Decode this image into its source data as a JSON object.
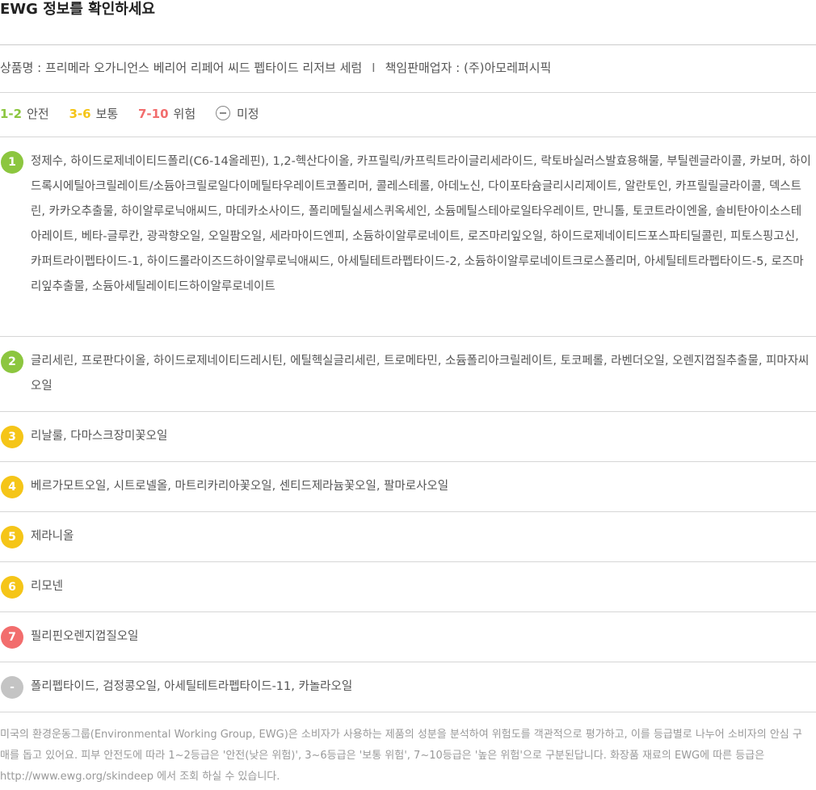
{
  "title": "EWG 정보를 확인하세요",
  "product": {
    "name_label": "상품명 : 프리메라 오가니언스 베리어 리페어 씨드 펩타이드 리저브 세럼",
    "separator": "I",
    "seller_label": "책임판매업자 : (주)아모레퍼시픽"
  },
  "legend": [
    {
      "range": "1-2",
      "label": "안전",
      "color": "#8cc63f"
    },
    {
      "range": "3-6",
      "label": "보통",
      "color": "#f5c518"
    },
    {
      "range": "7-10",
      "label": "위험",
      "color": "#f26d6d"
    },
    {
      "range": "",
      "label": "미정",
      "color": "#888888"
    }
  ],
  "grades": [
    {
      "badge": "1",
      "color": "#8cc63f",
      "ingredients": "정제수, 하이드로제네이티드폴리(C6-14올레핀), 1,2-헥산다이올, 카프릴릭/카프릭트라이글리세라이드, 락토바실러스발효용해물, 부틸렌글라이콜, 카보머, 하이드록시에틸아크릴레이트/소듐아크릴로일다이메틸타우레이트코폴리머, 콜레스테롤, 아데노신, 다이포타슘글리시리제이트, 알란토인, 카프릴릴글라이콜, 덱스트린, 카카오추출물, 하이알루로닉애씨드, 마데카소사이드, 폴리메틸실세스퀴옥세인, 소듐메틸스테아로일타우레이트, 만니톨, 토코트라이엔올, 솔비탄아이소스테아레이트, 베타-글루칸, 광곽향오일, 오일팜오일, 세라마이드엔피, 소듐하이알루로네이트, 로즈마리잎오일, 하이드로제네이티드포스파티딜콜린, 피토스핑고신, 카퍼트라이펩타이드-1, 하이드롤라이즈드하이알루로닉애씨드, 아세틸테트라펩타이드-2, 소듐하이알루로네이트크로스폴리머, 아세틸테트라펩타이드-5, 로즈마리잎추출물, 소듐아세틸레이티드하이알루로네이트"
    },
    {
      "badge": "2",
      "color": "#8cc63f",
      "ingredients": "글리세린, 프로판다이올, 하이드로제네이티드레시틴, 에틸헥실글리세린, 트로메타민, 소듐폴리아크릴레이트, 토코페롤, 라벤더오일, 오렌지껍질추출물, 피마자씨오일"
    },
    {
      "badge": "3",
      "color": "#f5c518",
      "ingredients": "리날룰, 다마스크장미꽃오일"
    },
    {
      "badge": "4",
      "color": "#f5c518",
      "ingredients": "베르가모트오일, 시트로넬올, 마트리카리아꽃오일, 센티드제라늄꽃오일, 팔마로사오일"
    },
    {
      "badge": "5",
      "color": "#f5c518",
      "ingredients": "제라니올"
    },
    {
      "badge": "6",
      "color": "#f5c518",
      "ingredients": "리모넨"
    },
    {
      "badge": "7",
      "color": "#f26d6d",
      "ingredients": "필리핀오렌지껍질오일"
    },
    {
      "badge": "-",
      "color": "#c4c4c4",
      "ingredients": "폴리펩타이드, 검정콩오일, 아세틸테트라펩타이드-11, 카놀라오일"
    }
  ],
  "footnote": "미국의 환경운동그룹(Environmental Working Group, EWG)은 소비자가 사용하는 제품의 성분을 분석하여 위험도를 객관적으로 평가하고, 이를 등급별로 나누어 소비자의 안심 구매를 돕고 있어요. 피부 안전도에 따라 1~2등급은 '안전(낮은 위험)', 3~6등급은 '보통 위험', 7~10등급은 '높은 위험'으로 구분된답니다. 화장품 재료의 EWG에 따른 등급은 http://www.ewg.org/skindeep 에서 조회 하실 수 있습니다."
}
